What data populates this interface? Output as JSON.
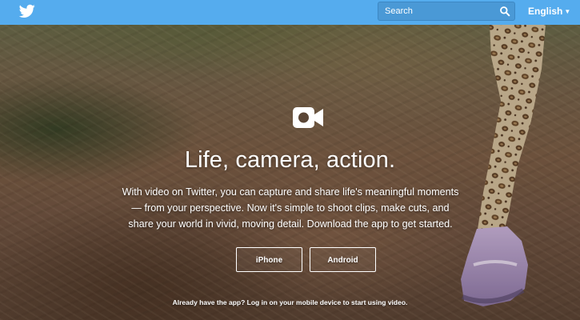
{
  "header": {
    "logo_icon": "twitter-bird-icon",
    "search": {
      "placeholder": "Search",
      "value": "",
      "icon": "search-icon"
    },
    "language": {
      "label": "English",
      "icon": "chevron-down-icon"
    },
    "background_color": "#55acee"
  },
  "hero": {
    "icon": "video-camera-icon",
    "headline": "Life, camera, action.",
    "description": "With video on Twitter, you can capture and share life's meaningful moments — from your perspective. Now it's simple to shoot clips, make cuts, and share your world in vivid, moving detail. Download the app to get started.",
    "buttons": {
      "iphone": "iPhone",
      "android": "Android"
    },
    "footnote": "Already have the app? Log in on your mobile device to start using video."
  }
}
